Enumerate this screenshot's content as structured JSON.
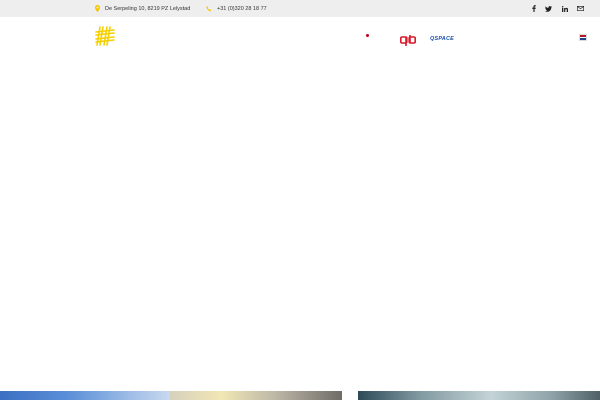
{
  "topbar": {
    "address": "De Serpeling 10, 8219 PZ Lelystad",
    "phone": "+31 (0)320 28 18 77",
    "social": [
      "facebook-icon",
      "twitter-icon",
      "linkedin-icon",
      "envelope-icon"
    ]
  },
  "header": {
    "partner_qb": "qb",
    "partner_qspace": "QSPACE",
    "language_flag": "netherlands-flag-icon"
  },
  "colors": {
    "accent": "#f5d000",
    "pin": "#f5c400",
    "qb_red": "#d61a2a",
    "qspace_blue": "#1a4fa8",
    "topbar_bg": "#eeeeee"
  }
}
